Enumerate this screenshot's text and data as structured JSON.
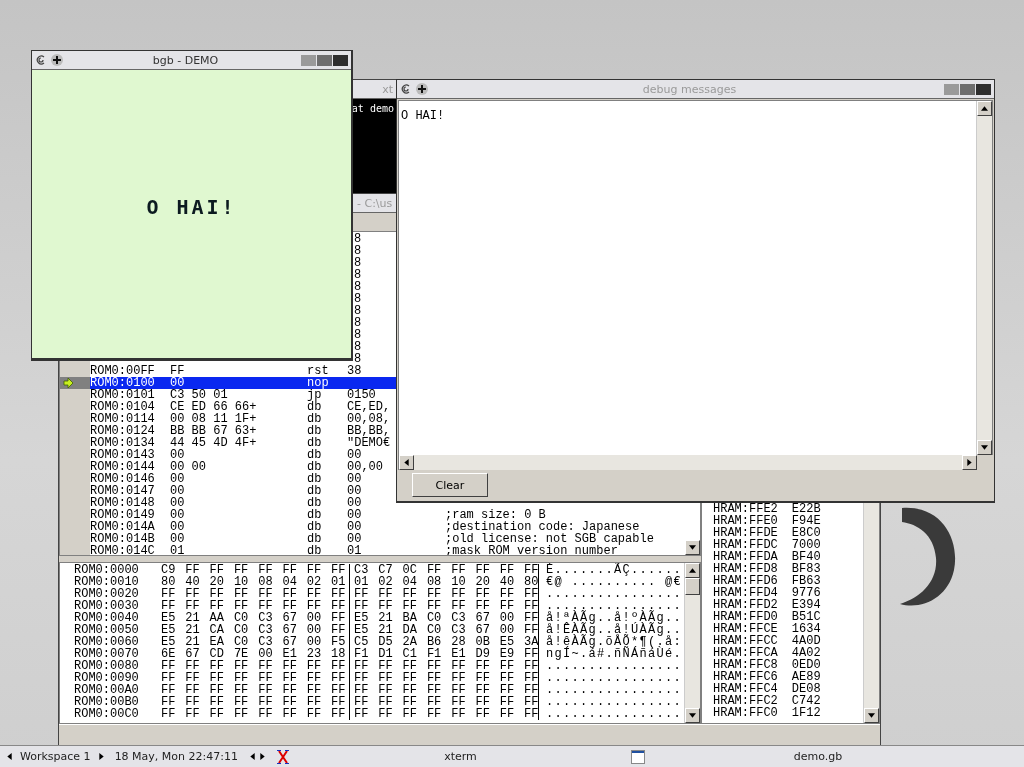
{
  "xterm_window": {
    "title": "xt",
    "terminal_text": "at demo"
  },
  "debugger_window": {
    "title": "- C:\\us",
    "disassembly": [
      {
        "kind": "covered",
        "operand_tail": "8",
        "selected": false,
        "pc": false
      },
      {
        "kind": "covered",
        "operand_tail": "8",
        "selected": false,
        "pc": false
      },
      {
        "kind": "covered",
        "operand_tail": "8",
        "selected": false,
        "pc": false
      },
      {
        "kind": "covered",
        "operand_tail": "8",
        "selected": false,
        "pc": false
      },
      {
        "kind": "covered",
        "operand_tail": "8",
        "selected": false,
        "pc": false
      },
      {
        "kind": "covered",
        "operand_tail": "8",
        "selected": false,
        "pc": false
      },
      {
        "kind": "covered",
        "operand_tail": "8",
        "selected": false,
        "pc": false
      },
      {
        "kind": "covered",
        "operand_tail": "8",
        "selected": false,
        "pc": false
      },
      {
        "kind": "covered",
        "operand_tail": "8",
        "selected": false,
        "pc": false
      },
      {
        "kind": "covered",
        "operand_tail": "8",
        "selected": false,
        "pc": false
      },
      {
        "kind": "covered",
        "operand_tail": "8",
        "selected": false,
        "pc": false
      },
      {
        "kind": "line",
        "address": "ROM0:00FF",
        "bytes": "FF",
        "mnemonic": "rst",
        "operand": "38",
        "selected": false,
        "pc": false
      },
      {
        "kind": "line",
        "address": "ROM0:0100",
        "bytes": "00",
        "mnemonic": "nop",
        "selected": true,
        "pc": true
      },
      {
        "kind": "line",
        "address": "ROM0:0101",
        "bytes": "C3 50 01",
        "mnemonic": "jp",
        "operand": "0150",
        "selected": false,
        "pc": false
      },
      {
        "kind": "line",
        "address": "ROM0:0104",
        "bytes": "CE ED 66 66+",
        "mnemonic": "db",
        "operand": "CE,ED,",
        "selected": false,
        "pc": false
      },
      {
        "kind": "line",
        "address": "ROM0:0114",
        "bytes": "00 08 11 1F+",
        "mnemonic": "db",
        "operand": "00,08,",
        "selected": false,
        "pc": false
      },
      {
        "kind": "line",
        "address": "ROM0:0124",
        "bytes": "BB BB 67 63+",
        "mnemonic": "db",
        "operand": "BB,BB,",
        "selected": false,
        "pc": false
      },
      {
        "kind": "line",
        "address": "ROM0:0134",
        "bytes": "44 45 4D 4F+",
        "mnemonic": "db",
        "operand": "\"DEMO€",
        "selected": false,
        "pc": false
      },
      {
        "kind": "line",
        "address": "ROM0:0143",
        "bytes": "00",
        "mnemonic": "db",
        "operand": "00",
        "selected": false,
        "pc": false
      },
      {
        "kind": "line",
        "address": "ROM0:0144",
        "bytes": "00 00",
        "mnemonic": "db",
        "operand": "00,00",
        "selected": false,
        "pc": false
      },
      {
        "kind": "line",
        "address": "ROM0:0146",
        "bytes": "00",
        "mnemonic": "db",
        "operand": "00",
        "selected": false,
        "pc": false
      },
      {
        "kind": "line",
        "address": "ROM0:0147",
        "bytes": "00",
        "mnemonic": "db",
        "operand": "00",
        "selected": false,
        "pc": false
      },
      {
        "kind": "line",
        "address": "ROM0:0148",
        "bytes": "00",
        "mnemonic": "db",
        "operand": "00",
        "selected": false,
        "pc": false
      },
      {
        "kind": "line",
        "address": "ROM0:0149",
        "bytes": "00",
        "mnemonic": "db",
        "operand": "00",
        "comment": ";ram size: 0 B",
        "selected": false,
        "pc": false
      },
      {
        "kind": "line",
        "address": "ROM0:014A",
        "bytes": "00",
        "mnemonic": "db",
        "operand": "00",
        "comment": ";destination code: Japanese",
        "selected": false,
        "pc": false
      },
      {
        "kind": "line",
        "address": "ROM0:014B",
        "bytes": "00",
        "mnemonic": "db",
        "operand": "00",
        "comment": ";old license: not SGB capable",
        "selected": false,
        "pc": false
      },
      {
        "kind": "line",
        "address": "ROM0:014C",
        "bytes": "01",
        "mnemonic": "db",
        "operand": "01",
        "comment": ";mask ROM version number",
        "selected": false,
        "pc": false
      }
    ],
    "memory": [
      {
        "address": "ROM0:0000",
        "bytes_1": "C9 FF FF FF FF FF FF FF",
        "bytes_2": "C3 C7 0C FF FF FF FF FF",
        "ascii": "É.......ÃÇ......"
      },
      {
        "address": "ROM0:0010",
        "bytes_1": "80 40 20 10 08 04 02 01",
        "bytes_2": "01 02 04 08 10 20 40 80",
        "ascii": "€@ .......... @€"
      },
      {
        "address": "ROM0:0020",
        "bytes_1": "FF FF FF FF FF FF FF FF",
        "bytes_2": "FF FF FF FF FF FF FF FF",
        "ascii": "................"
      },
      {
        "address": "ROM0:0030",
        "bytes_1": "FF FF FF FF FF FF FF FF",
        "bytes_2": "FF FF FF FF FF FF FF FF",
        "ascii": "................"
      },
      {
        "address": "ROM0:0040",
        "bytes_1": "E5 21 AA C0 C3 67 00 FF",
        "bytes_2": "E5 21 BA C0 C3 67 00 FF",
        "ascii": "å!ªÀÃg..å!ºÀÃg.."
      },
      {
        "address": "ROM0:0050",
        "bytes_1": "E5 21 CA C0 C3 67 00 FF",
        "bytes_2": "E5 21 DA C0 C3 67 00 FF",
        "ascii": "å!ÊÀÃg..å!ÚÀÃg.."
      },
      {
        "address": "ROM0:0060",
        "bytes_1": "E5 21 EA C0 C3 67 00 F5",
        "bytes_2": "C5 D5 2A B6 28 0B E5 3A",
        "ascii": "å!êÀÃg.õÅÕ*¶(.å:"
      },
      {
        "address": "ROM0:0070",
        "bytes_1": "6E 67 CD 7E 00 E1 23 18",
        "bytes_2": "F1 D1 C1 F1 E1 D9 E9 FF",
        "ascii": "ngÍ~.á#.ñÑÁñáÙé."
      },
      {
        "address": "ROM0:0080",
        "bytes_1": "FF FF FF FF FF FF FF FF",
        "bytes_2": "FF FF FF FF FF FF FF FF",
        "ascii": "................"
      },
      {
        "address": "ROM0:0090",
        "bytes_1": "FF FF FF FF FF FF FF FF",
        "bytes_2": "FF FF FF FF FF FF FF FF",
        "ascii": "................"
      },
      {
        "address": "ROM0:00A0",
        "bytes_1": "FF FF FF FF FF FF FF FF",
        "bytes_2": "FF FF FF FF FF FF FF FF",
        "ascii": "................"
      },
      {
        "address": "ROM0:00B0",
        "bytes_1": "FF FF FF FF FF FF FF FF",
        "bytes_2": "FF FF FF FF FF FF FF FF",
        "ascii": "................"
      },
      {
        "address": "ROM0:00C0",
        "bytes_1": "FF FF FF FF FF FF FF FF",
        "bytes_2": "FF FF FF FF FF FF FF FF",
        "ascii": "................"
      }
    ],
    "stack": [
      {
        "address": "HRAM:FFE2",
        "value": "E22B"
      },
      {
        "address": "HRAM:FFE0",
        "value": "F94E"
      },
      {
        "address": "HRAM:FFDE",
        "value": "E8C0"
      },
      {
        "address": "HRAM:FFDC",
        "value": "7000"
      },
      {
        "address": "HRAM:FFDA",
        "value": "BF40"
      },
      {
        "address": "HRAM:FFD8",
        "value": "BF83"
      },
      {
        "address": "HRAM:FFD6",
        "value": "FB63"
      },
      {
        "address": "HRAM:FFD4",
        "value": "9776"
      },
      {
        "address": "HRAM:FFD2",
        "value": "E394"
      },
      {
        "address": "HRAM:FFD0",
        "value": "B51C"
      },
      {
        "address": "HRAM:FFCE",
        "value": "1634"
      },
      {
        "address": "HRAM:FFCC",
        "value": "4A0D"
      },
      {
        "address": "HRAM:FFCA",
        "value": "4A02"
      },
      {
        "address": "HRAM:FFC8",
        "value": "0ED0"
      },
      {
        "address": "HRAM:FFC6",
        "value": "AE89"
      },
      {
        "address": "HRAM:FFC4",
        "value": "DE08"
      },
      {
        "address": "HRAM:FFC2",
        "value": "C742"
      },
      {
        "address": "HRAM:FFC0",
        "value": "1F12"
      }
    ]
  },
  "game_window": {
    "title": "bgb - DEMO",
    "active": true,
    "screen_text": "O HAI!"
  },
  "debug_window": {
    "title": "debug messages",
    "active": false,
    "log": "O HAI!",
    "clear_button": "Clear"
  },
  "taskbar": {
    "workspace": "Workspace 1",
    "clock": "18 May, Mon 22:47:11",
    "tasks": [
      {
        "kind": "xterm",
        "label": "xterm"
      },
      {
        "kind": "window",
        "label": "demo.gb"
      }
    ]
  }
}
